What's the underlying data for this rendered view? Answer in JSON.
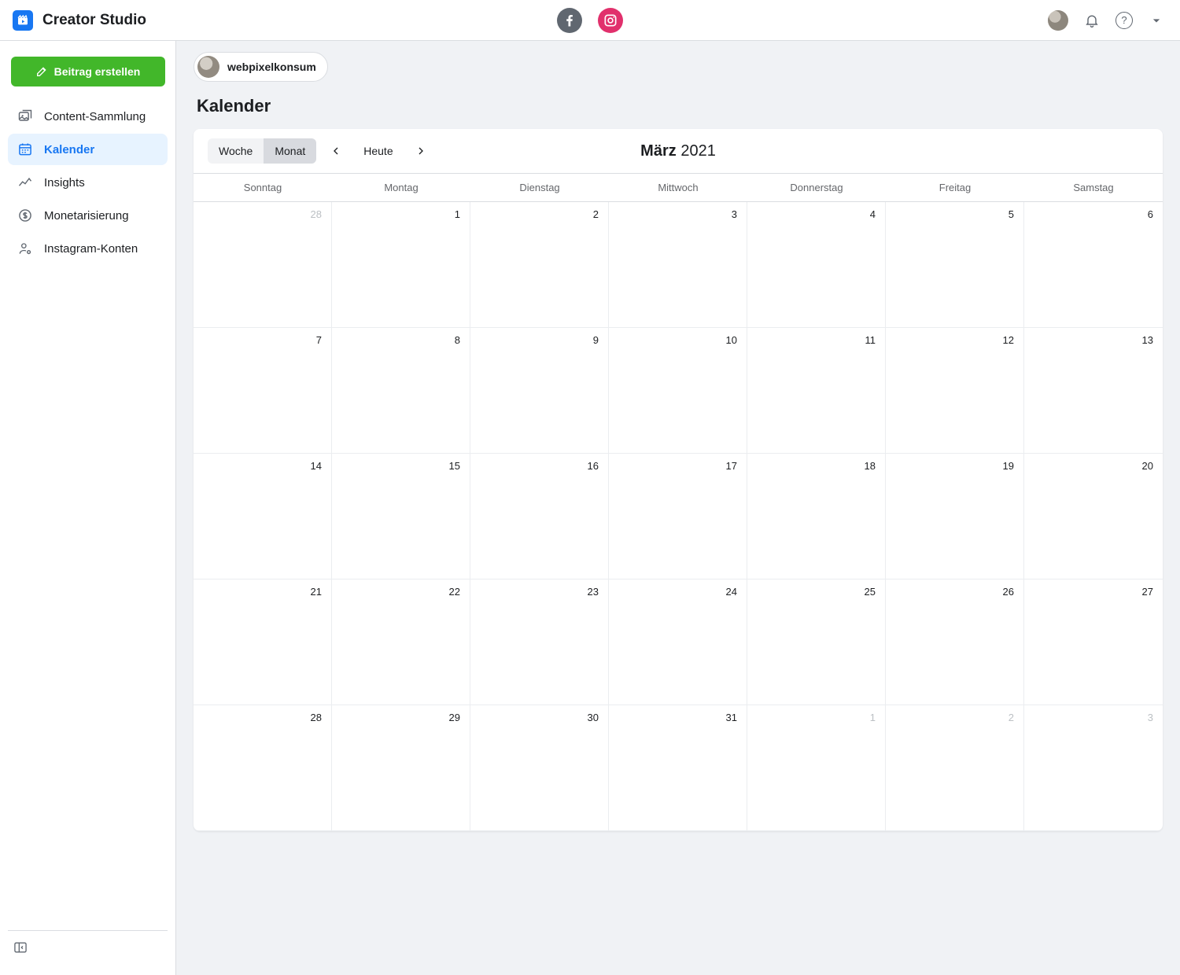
{
  "app_title": "Creator Studio",
  "create_button": "Beitrag erstellen",
  "sidebar": {
    "items": [
      {
        "label": "Content-Sammlung"
      },
      {
        "label": "Kalender"
      },
      {
        "label": "Insights"
      },
      {
        "label": "Monetarisierung"
      },
      {
        "label": "Instagram-Konten"
      }
    ]
  },
  "account_name": "webpixelkonsum",
  "page_title": "Kalender",
  "toolbar": {
    "week": "Woche",
    "month": "Monat",
    "today": "Heute"
  },
  "calendar": {
    "month": "März",
    "year": "2021",
    "weekdays": [
      "Sonntag",
      "Montag",
      "Dienstag",
      "Mittwoch",
      "Donnerstag",
      "Freitag",
      "Samstag"
    ],
    "cells": [
      {
        "d": "28",
        "out": true
      },
      {
        "d": "1"
      },
      {
        "d": "2"
      },
      {
        "d": "3"
      },
      {
        "d": "4"
      },
      {
        "d": "5"
      },
      {
        "d": "6"
      },
      {
        "d": "7"
      },
      {
        "d": "8"
      },
      {
        "d": "9"
      },
      {
        "d": "10"
      },
      {
        "d": "11"
      },
      {
        "d": "12"
      },
      {
        "d": "13"
      },
      {
        "d": "14"
      },
      {
        "d": "15"
      },
      {
        "d": "16"
      },
      {
        "d": "17"
      },
      {
        "d": "18"
      },
      {
        "d": "19"
      },
      {
        "d": "20"
      },
      {
        "d": "21"
      },
      {
        "d": "22"
      },
      {
        "d": "23"
      },
      {
        "d": "24"
      },
      {
        "d": "25"
      },
      {
        "d": "26"
      },
      {
        "d": "27"
      },
      {
        "d": "28"
      },
      {
        "d": "29"
      },
      {
        "d": "30"
      },
      {
        "d": "31"
      },
      {
        "d": "1",
        "out": true
      },
      {
        "d": "2",
        "out": true
      },
      {
        "d": "3",
        "out": true
      }
    ]
  }
}
